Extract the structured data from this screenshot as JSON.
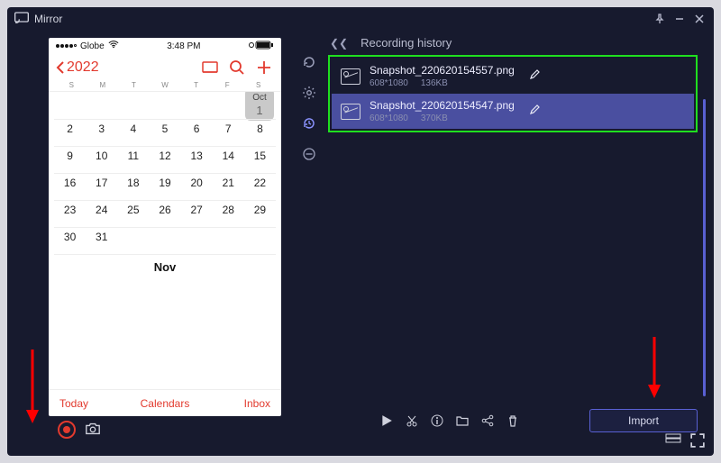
{
  "app": {
    "title": "Mirror"
  },
  "phone": {
    "carrier": "Globe",
    "time": "3:48 PM",
    "year": "2022",
    "weekdays": [
      "S",
      "M",
      "T",
      "W",
      "T",
      "F",
      "S"
    ],
    "oct_label": "Oct",
    "oct_day": "1",
    "rows": [
      [
        "2",
        "3",
        "4",
        "5",
        "6",
        "7",
        "8"
      ],
      [
        "9",
        "10",
        "11",
        "12",
        "13",
        "14",
        "15"
      ],
      [
        "16",
        "17",
        "18",
        "19",
        "20",
        "21",
        "22"
      ],
      [
        "23",
        "24",
        "25",
        "26",
        "27",
        "28",
        "29"
      ],
      [
        "30",
        "31",
        "",
        "",
        "",
        "",
        ""
      ]
    ],
    "next_month": "Nov",
    "footer": {
      "today": "Today",
      "calendars": "Calendars",
      "inbox": "Inbox"
    }
  },
  "history": {
    "title": "Recording history",
    "items": [
      {
        "name": "Snapshot_220620154557.png",
        "dims": "608*1080",
        "size": "136KB",
        "selected": false
      },
      {
        "name": "Snapshot_220620154547.png",
        "dims": "608*1080",
        "size": "370KB",
        "selected": true
      }
    ],
    "import_label": "Import"
  }
}
